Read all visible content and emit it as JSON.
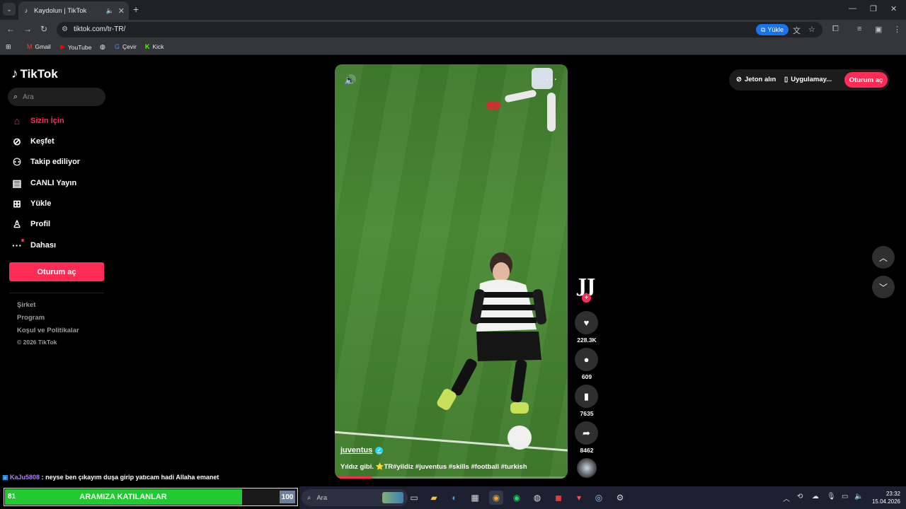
{
  "browser": {
    "tab_title": "Kaydolun | TikTok",
    "url": "tiktok.com/tr-TR/",
    "install_chip": "Yükle",
    "bookmarks": [
      "Gmail",
      "YouTube",
      "Çevir",
      "Kick"
    ]
  },
  "sidebar": {
    "brand": "TikTok",
    "search_placeholder": "Ara",
    "nav": [
      {
        "label": "Sizin İçin",
        "icon": "home-icon"
      },
      {
        "label": "Keşfet",
        "icon": "compass-icon"
      },
      {
        "label": "Takip ediliyor",
        "icon": "following-icon"
      },
      {
        "label": "CANLI Yayın",
        "icon": "live-tv-icon"
      },
      {
        "label": "Yükle",
        "icon": "upload-plus-icon"
      },
      {
        "label": "Profil",
        "icon": "profile-icon"
      },
      {
        "label": "Dahası",
        "icon": "more-dots-icon"
      }
    ],
    "login_button": "Oturum aç",
    "footer": [
      "Şirket",
      "Program",
      "Koşul ve Politikalar"
    ],
    "copyright": "© 2026 TikTok"
  },
  "header_actions": {
    "coins": "Jeton alın",
    "app": "Uygulamay...",
    "login": "Oturum aç"
  },
  "video": {
    "username": "juventus",
    "caption": "Yıldız gibi. ⭐TR#yildiz #juventus #skills #football #turkish",
    "progress": 0.16
  },
  "actions": {
    "likes": "228.3K",
    "comments": "609",
    "saves": "7635",
    "shares": "8462"
  },
  "stream_overlay": {
    "chat_user": "KaJu5808",
    "chat_message": ": neyse ben çıkayım duşa girip yatıcam hadi Allaha emanet",
    "banner_left": "81",
    "banner_label": "ARAMIZA KATILANLAR",
    "banner_right": "100",
    "banner_progress": 0.81
  },
  "taskbar": {
    "search_placeholder": "Ara",
    "time": "23:32",
    "date": "15.04.2026"
  },
  "colors": {
    "accent": "#fe2c55",
    "banner_green": "#22c931"
  }
}
